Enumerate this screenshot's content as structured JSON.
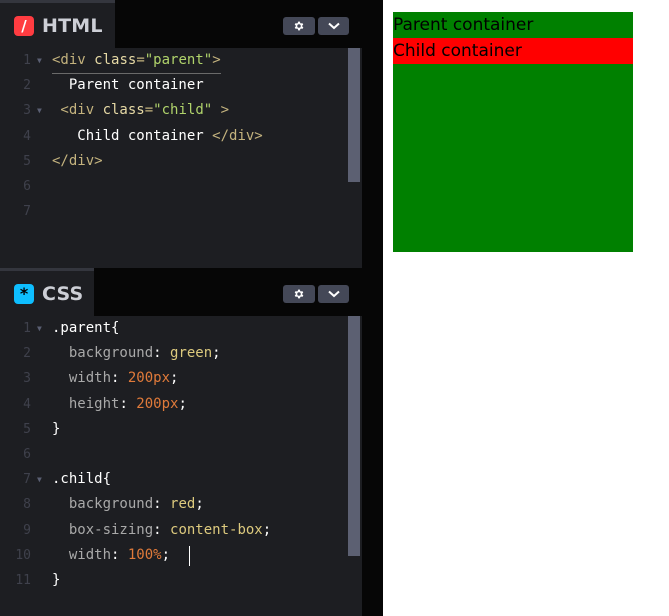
{
  "html_panel": {
    "title": "HTML",
    "icon": "html-icon",
    "icon_glyph": "/",
    "lines": [
      {
        "n": "1",
        "fold": true,
        "tokens": [
          {
            "t": "<div ",
            "c": "tag"
          },
          {
            "t": "class",
            "c": "attr"
          },
          {
            "t": "=",
            "c": "tag"
          },
          {
            "t": "\"parent\"",
            "c": "str"
          },
          {
            "t": ">",
            "c": "tag"
          }
        ]
      },
      {
        "n": "2",
        "fold": false,
        "tokens": [
          {
            "t": "  Parent container",
            "c": "text"
          }
        ]
      },
      {
        "n": "3",
        "fold": true,
        "tokens": [
          {
            "t": " <div ",
            "c": "tag"
          },
          {
            "t": "class",
            "c": "attr"
          },
          {
            "t": "=",
            "c": "tag"
          },
          {
            "t": "\"child\"",
            "c": "str"
          },
          {
            "t": " >",
            "c": "tag"
          }
        ]
      },
      {
        "n": "4",
        "fold": false,
        "tokens": [
          {
            "t": "   Child container ",
            "c": "text"
          },
          {
            "t": "</div>",
            "c": "tag"
          }
        ]
      },
      {
        "n": "5",
        "fold": false,
        "tokens": [
          {
            "t": "</div>",
            "c": "tag"
          }
        ]
      },
      {
        "n": "6",
        "fold": false,
        "tokens": []
      },
      {
        "n": "7",
        "fold": false,
        "tokens": []
      }
    ]
  },
  "css_panel": {
    "title": "CSS",
    "icon": "css-icon",
    "icon_glyph": "*",
    "lines": [
      {
        "n": "1",
        "fold": true,
        "tokens": [
          {
            "t": ".parent",
            "c": "sel"
          },
          {
            "t": "{",
            "c": "punc"
          }
        ]
      },
      {
        "n": "2",
        "fold": false,
        "tokens": [
          {
            "t": "  background",
            "c": "prop"
          },
          {
            "t": ": ",
            "c": "punc"
          },
          {
            "t": "green",
            "c": "val"
          },
          {
            "t": ";",
            "c": "punc"
          }
        ]
      },
      {
        "n": "3",
        "fold": false,
        "tokens": [
          {
            "t": "  width",
            "c": "prop"
          },
          {
            "t": ": ",
            "c": "punc"
          },
          {
            "t": "200px",
            "c": "num"
          },
          {
            "t": ";",
            "c": "punc"
          }
        ]
      },
      {
        "n": "4",
        "fold": false,
        "tokens": [
          {
            "t": "  height",
            "c": "prop"
          },
          {
            "t": ": ",
            "c": "punc"
          },
          {
            "t": "200px",
            "c": "num"
          },
          {
            "t": ";",
            "c": "punc"
          }
        ]
      },
      {
        "n": "5",
        "fold": false,
        "tokens": [
          {
            "t": "}",
            "c": "punc"
          }
        ]
      },
      {
        "n": "6",
        "fold": false,
        "tokens": []
      },
      {
        "n": "7",
        "fold": true,
        "tokens": [
          {
            "t": ".child",
            "c": "sel"
          },
          {
            "t": "{",
            "c": "punc"
          }
        ]
      },
      {
        "n": "8",
        "fold": false,
        "tokens": [
          {
            "t": "  background",
            "c": "prop"
          },
          {
            "t": ": ",
            "c": "punc"
          },
          {
            "t": "red",
            "c": "val"
          },
          {
            "t": ";",
            "c": "punc"
          }
        ]
      },
      {
        "n": "9",
        "fold": false,
        "tokens": [
          {
            "t": "  box-sizing",
            "c": "prop"
          },
          {
            "t": ": ",
            "c": "punc"
          },
          {
            "t": "content-box",
            "c": "val"
          },
          {
            "t": ";",
            "c": "punc"
          }
        ]
      },
      {
        "n": "10",
        "fold": false,
        "tokens": [
          {
            "t": "  width",
            "c": "prop"
          },
          {
            "t": ": ",
            "c": "punc"
          },
          {
            "t": "100%",
            "c": "num"
          },
          {
            "t": ";",
            "c": "punc"
          }
        ]
      },
      {
        "n": "11",
        "fold": false,
        "tokens": [
          {
            "t": "}",
            "c": "punc"
          }
        ]
      }
    ]
  },
  "preview": {
    "parent_text": "Parent container",
    "child_text": "Child container",
    "parent_color": "#008000",
    "child_color": "#ff0000"
  },
  "icons": {
    "settings": "gear-icon",
    "collapse": "chevron-down-icon"
  }
}
